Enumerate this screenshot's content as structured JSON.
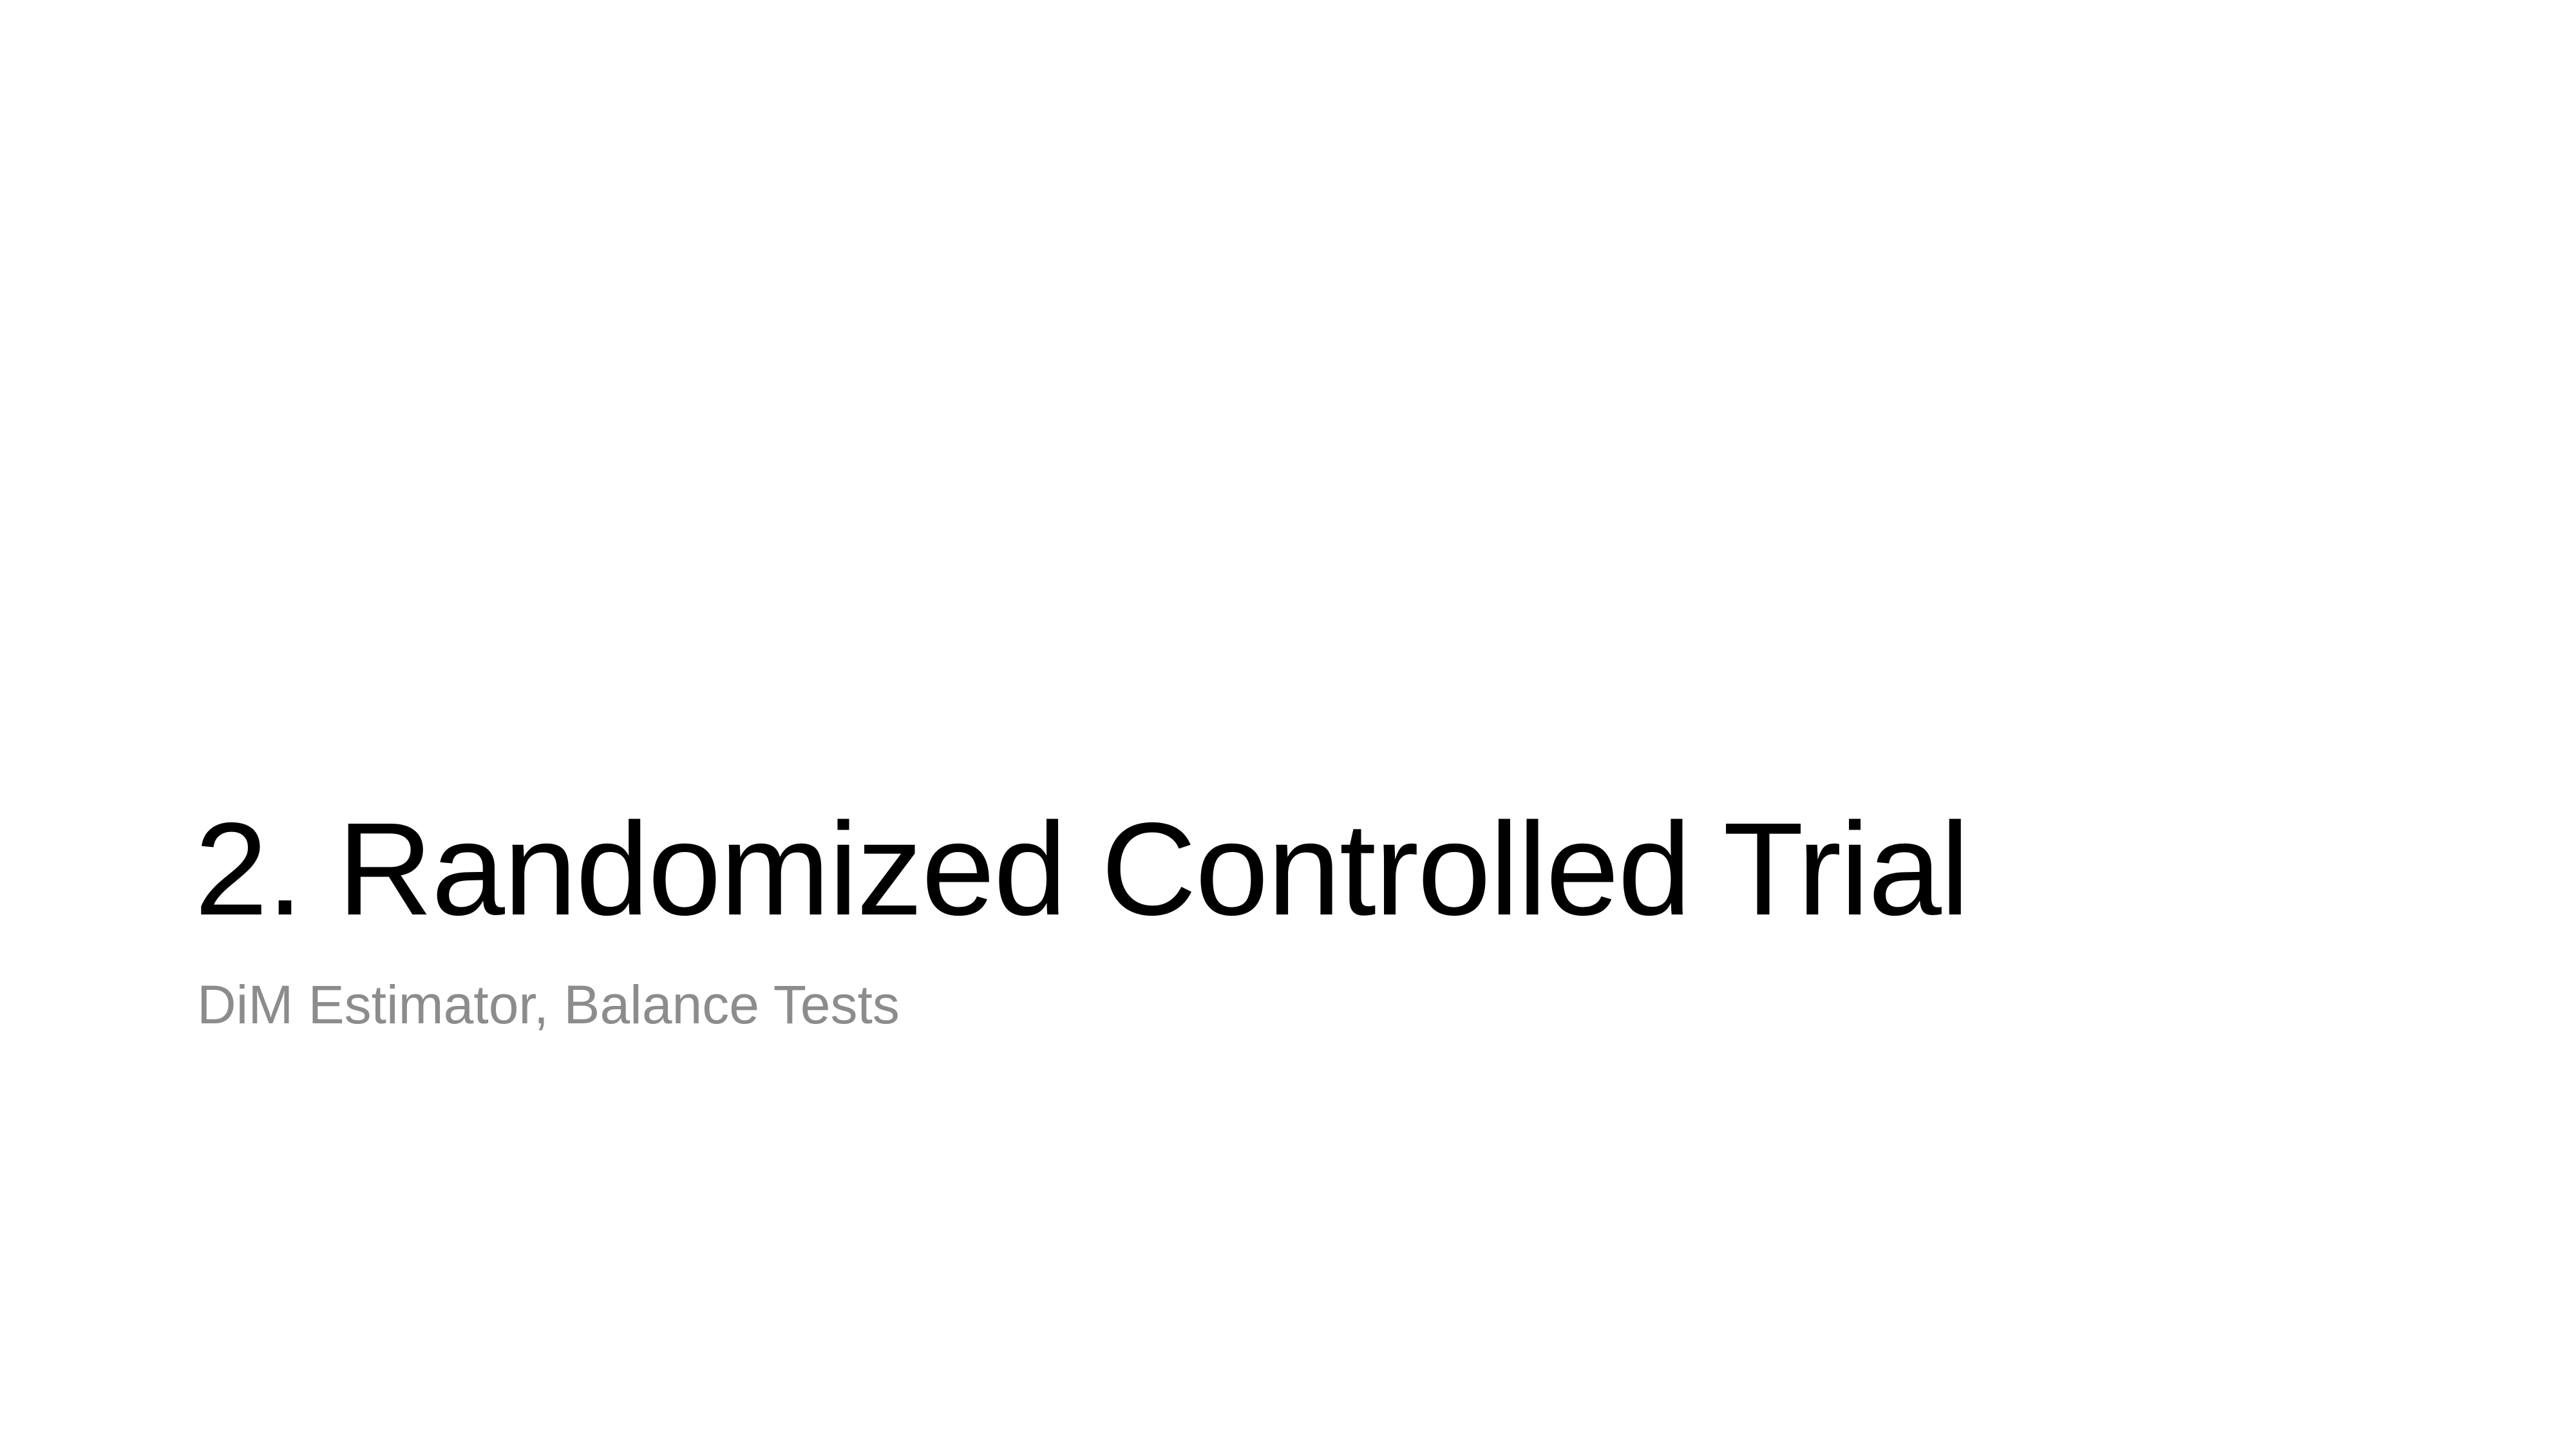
{
  "slide": {
    "title": "2. Randomized Controlled Trial",
    "subtitle": "DiM Estimator, Balance Tests"
  },
  "colors": {
    "background": "#ffffff",
    "title_text": "#000000",
    "subtitle_text": "#8c8c8c"
  }
}
